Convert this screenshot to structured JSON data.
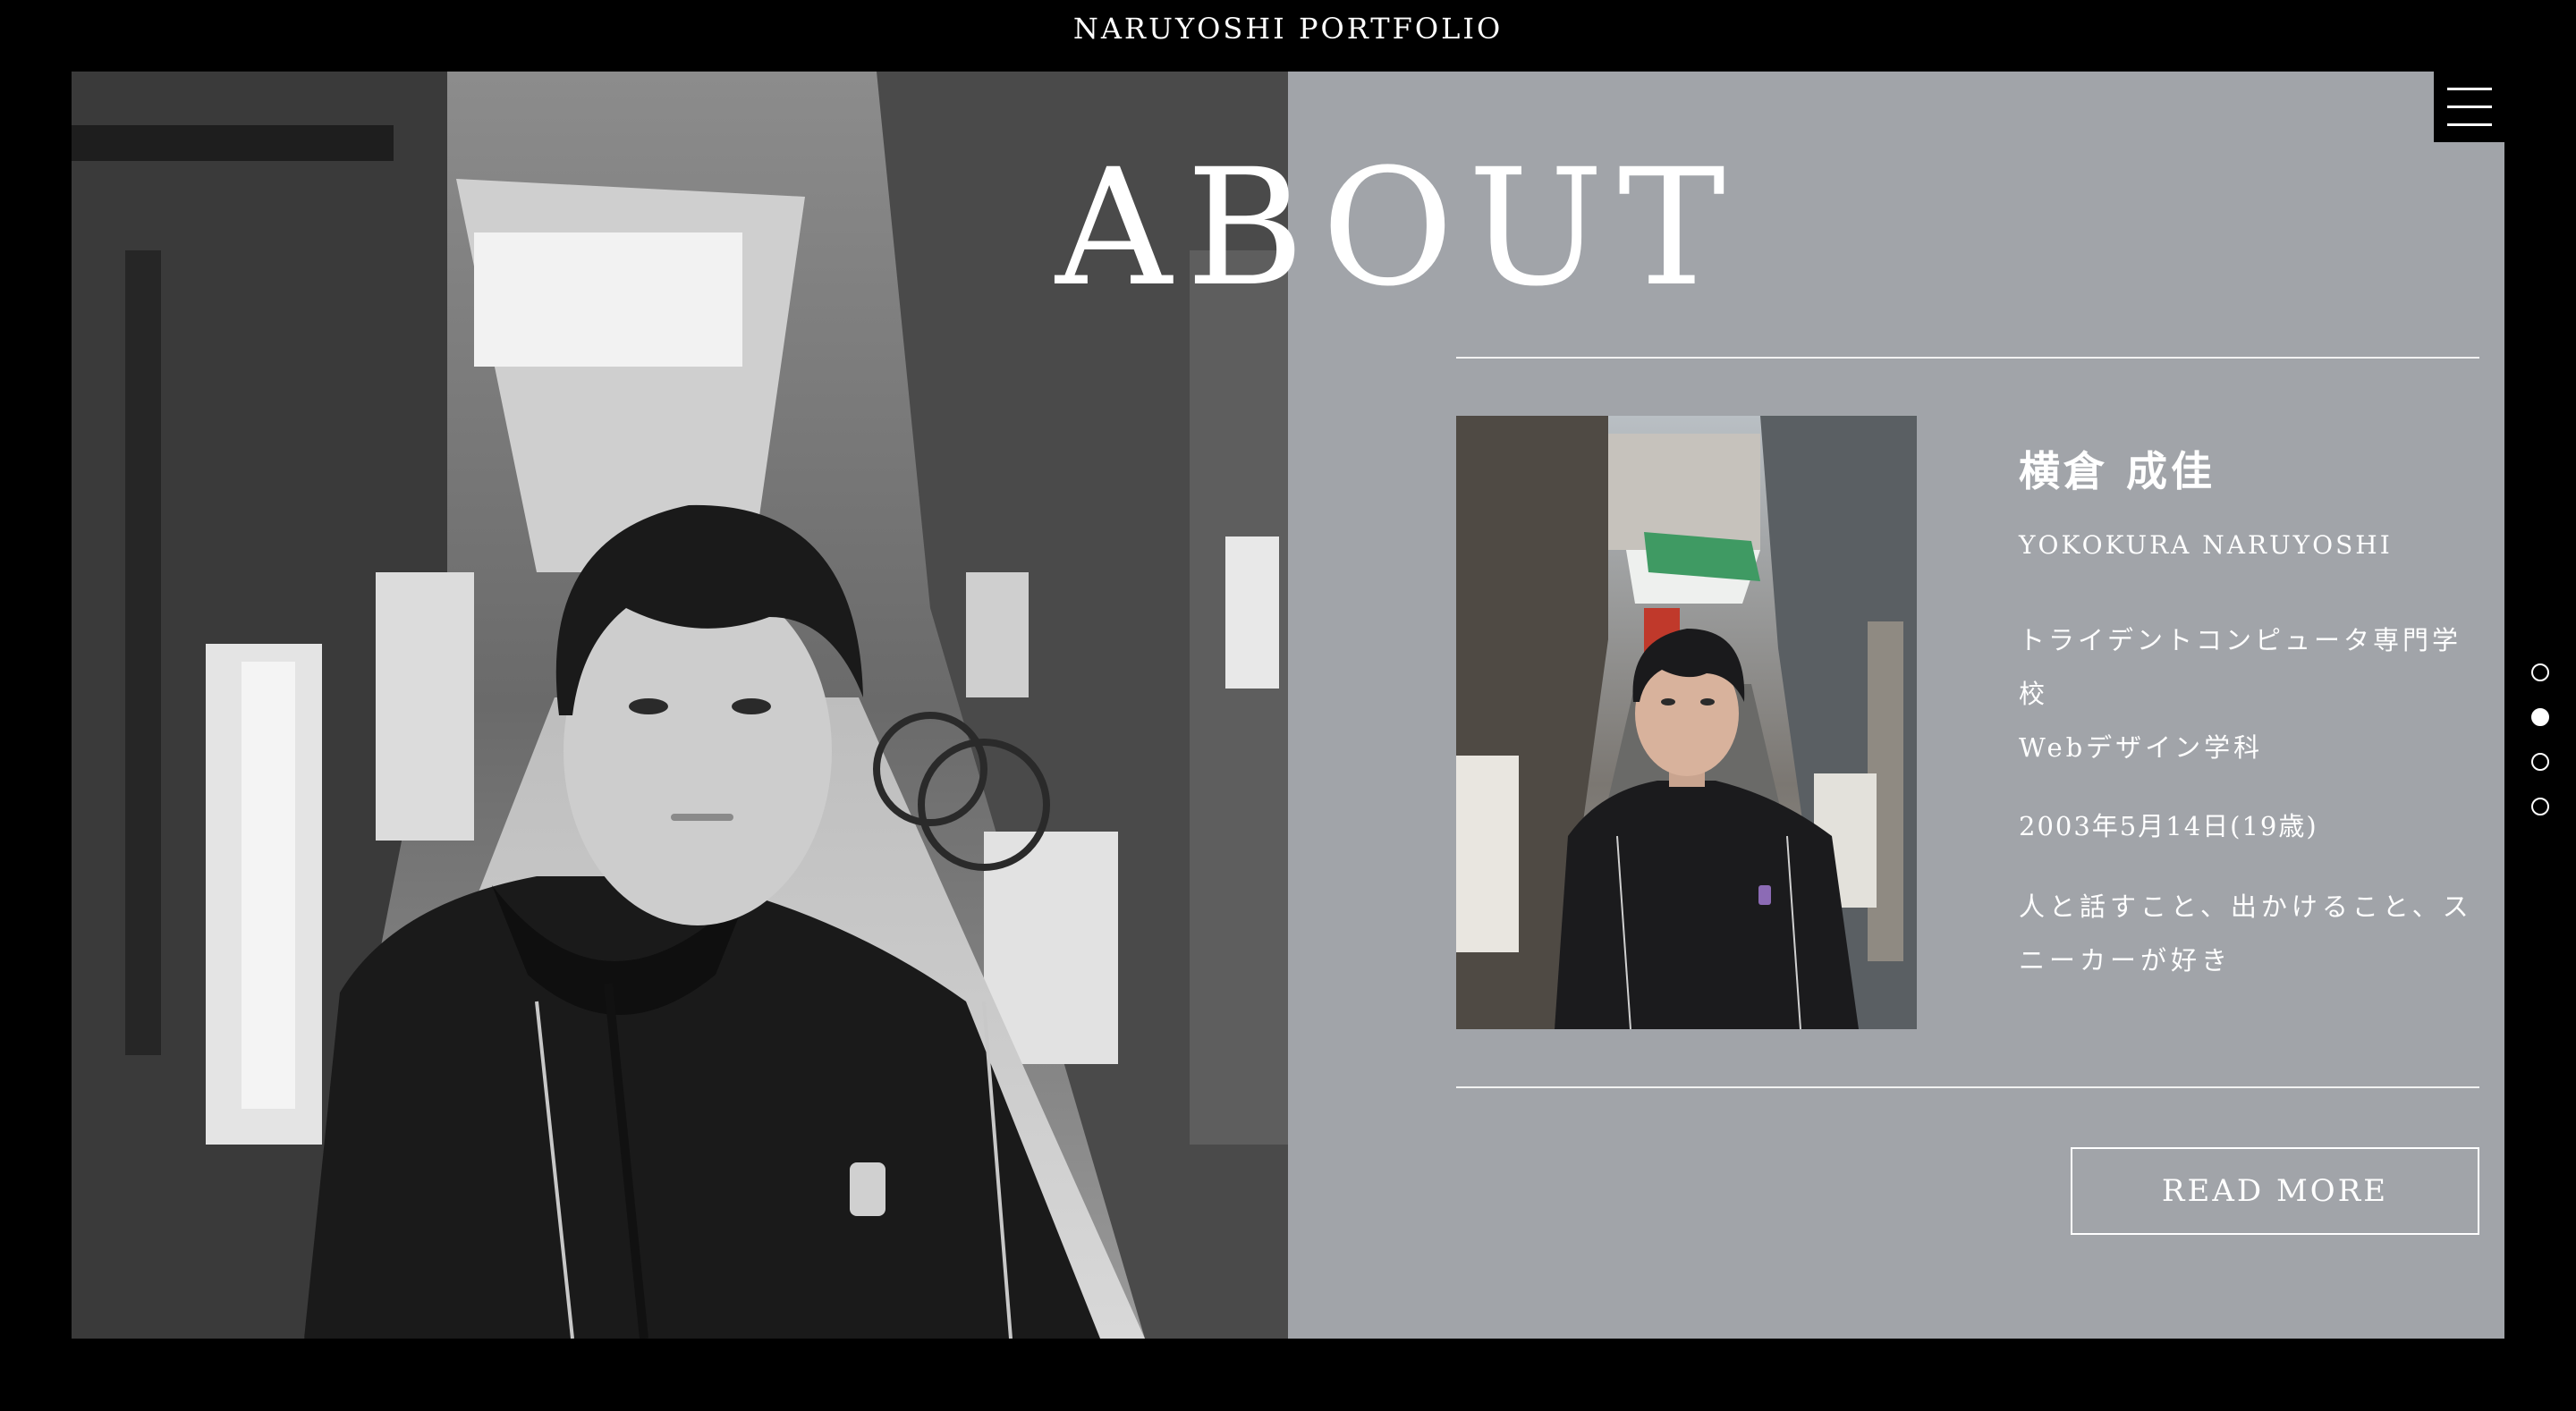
{
  "header": {
    "site_title": "NARUYOSHI PORTFOLIO"
  },
  "about": {
    "heading": "ABOUT",
    "name_jp": "横倉 成佳",
    "name_en": "YOKOKURA NARUYOSHI",
    "school_line1": "トライデントコンピュータ専門学",
    "school_line2": "校",
    "department": "Webデザイン学科",
    "birthdate": "2003年5月14日(19歳)",
    "hobby_line1": "人と話すこと、出かけること、ス",
    "hobby_line2": "ニーカーが好き",
    "read_more_label": "READ MORE"
  },
  "dot_nav": {
    "active_index": 1,
    "count": 4
  },
  "icons": {
    "menu": "hamburger-menu-icon"
  },
  "colors": {
    "background": "#000000",
    "panel": "#a1a4a9",
    "text": "#ffffff"
  }
}
